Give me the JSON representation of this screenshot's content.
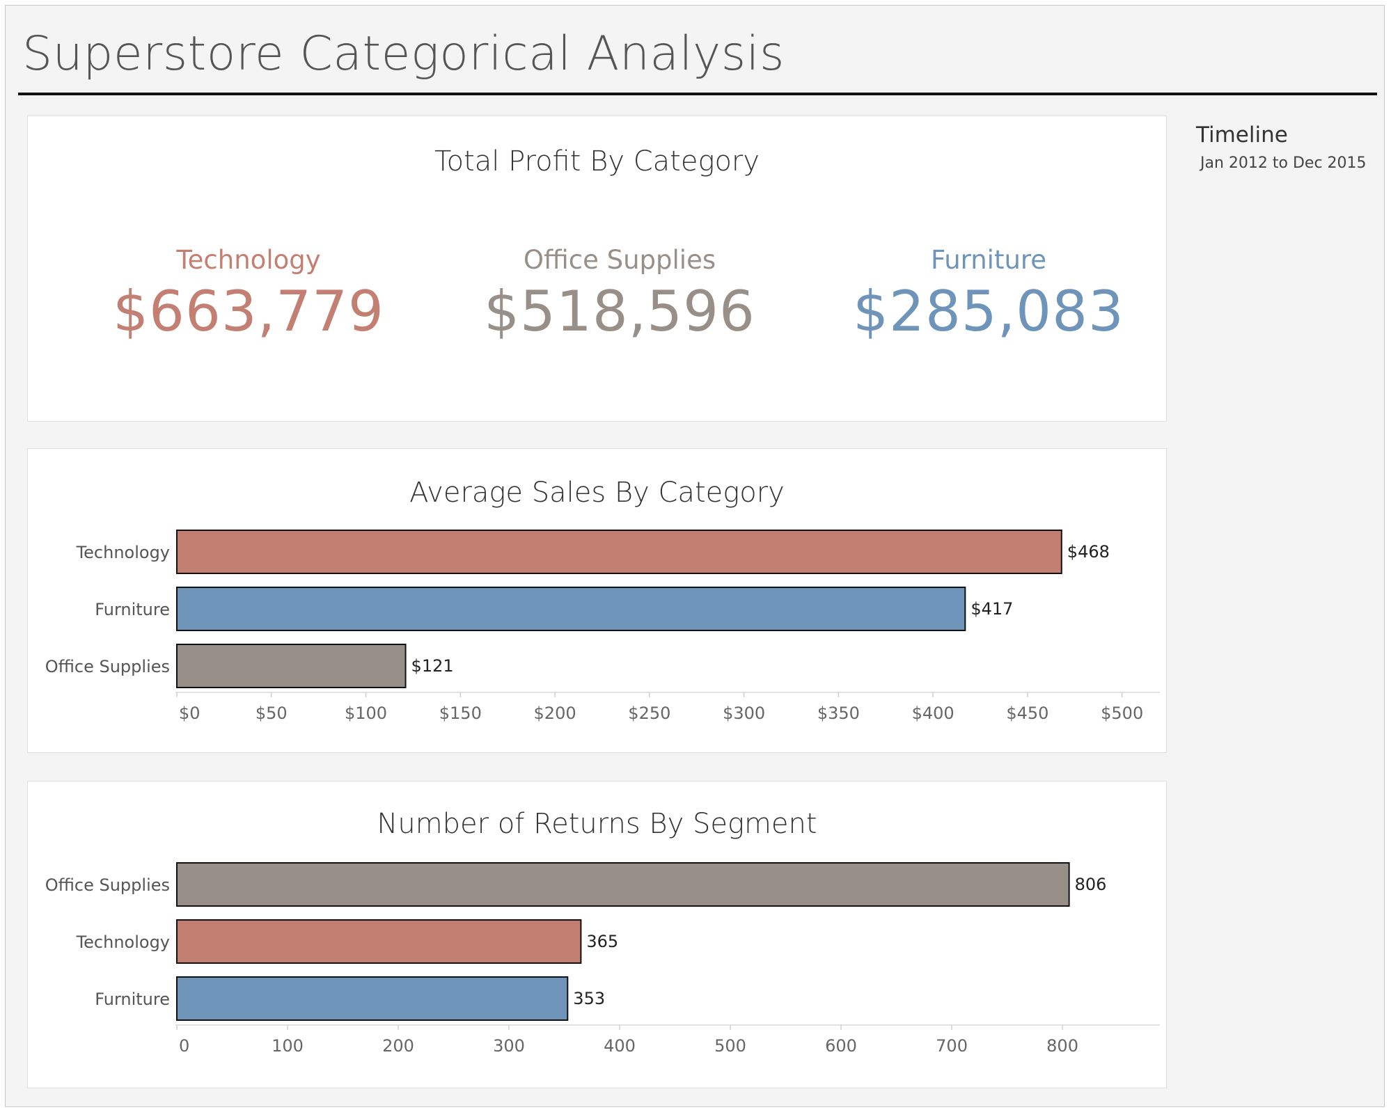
{
  "page": {
    "title": "Superstore Categorical Analysis"
  },
  "timeline": {
    "title": "Timeline",
    "range": "Jan 2012 to Dec 2015"
  },
  "colors": {
    "Technology": "#c47f73",
    "Office Supplies": "#978f88",
    "Furniture": "#6f94b9"
  },
  "profit": {
    "title": "Total Profit By Category",
    "kpis": [
      {
        "category": "Technology",
        "value": "$663,779",
        "color": "#c47f73"
      },
      {
        "category": "Office Supplies",
        "value": "$518,596",
        "color": "#978f88"
      },
      {
        "category": "Furniture",
        "value": "$285,083",
        "color": "#6f94b9"
      }
    ]
  },
  "chart_data": [
    {
      "type": "bar",
      "orientation": "horizontal",
      "title": "Average Sales By Category",
      "categories": [
        "Technology",
        "Furniture",
        "Office Supplies"
      ],
      "values": [
        468,
        417,
        121
      ],
      "value_labels": [
        "$468",
        "$417",
        "$121"
      ],
      "xlim": [
        0,
        520
      ],
      "x_ticks": [
        0,
        50,
        100,
        150,
        200,
        250,
        300,
        350,
        400,
        450,
        500
      ],
      "x_tick_labels": [
        "$0",
        "$50",
        "$100",
        "$150",
        "$200",
        "$250",
        "$300",
        "$350",
        "$400",
        "$450",
        "$500"
      ],
      "grid": false,
      "xlabel": "",
      "ylabel": ""
    },
    {
      "type": "bar",
      "orientation": "horizontal",
      "title": "Number of Returns By Segment",
      "categories": [
        "Office Supplies",
        "Technology",
        "Furniture"
      ],
      "values": [
        806,
        365,
        353
      ],
      "value_labels": [
        "806",
        "365",
        "353"
      ],
      "xlim": [
        0,
        888
      ],
      "x_ticks": [
        0,
        100,
        200,
        300,
        400,
        500,
        600,
        700,
        800
      ],
      "x_tick_labels": [
        "0",
        "100",
        "200",
        "300",
        "400",
        "500",
        "600",
        "700",
        "800"
      ],
      "grid": false,
      "xlabel": "",
      "ylabel": ""
    }
  ]
}
